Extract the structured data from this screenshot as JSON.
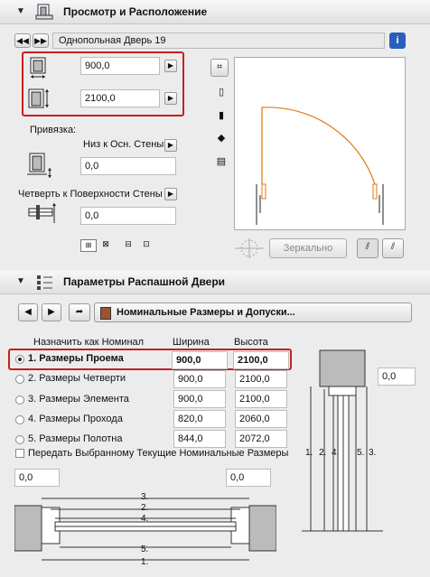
{
  "panel1": {
    "title": "Просмотр и Расположение",
    "door_name": "Однопольная Дверь 19",
    "width_value": "900,0",
    "height_value": "2100,0",
    "anchor_label": "Привязка:",
    "anchor_option": "Низ к Осн. Стены",
    "anchor_value": "0,0",
    "reveal_option": "Четверть к Поверхности Стены",
    "reveal_value": "0,0",
    "mirror_button": "Зеркально"
  },
  "panel2": {
    "title": "Параметры Распашной Двери",
    "page_selector": "Номинальные Размеры и Допуски...",
    "nominal_header": "Назначить как Номинал",
    "col_width": "Ширина",
    "col_height": "Высота",
    "rows": [
      {
        "label": "1. Размеры Проема",
        "width": "900,0",
        "height": "2100,0",
        "selected": true
      },
      {
        "label": "2. Размеры Четверти",
        "width": "900,0",
        "height": "2100,0",
        "selected": false
      },
      {
        "label": "3. Размеры Элемента",
        "width": "900,0",
        "height": "2100,0",
        "selected": false
      },
      {
        "label": "4. Размеры Прохода",
        "width": "820,0",
        "height": "2060,0",
        "selected": false
      },
      {
        "label": "5. Размеры Полотна",
        "width": "844,0",
        "height": "2072,0",
        "selected": false
      }
    ],
    "pass_checkbox": "Передать Выбранному Текущие Номинальные Размеры",
    "right_offset": "0,0",
    "left_bottom_value": "0,0",
    "right_bottom_value": "0,0",
    "section_numbers": [
      "1.",
      "2.",
      "4.",
      "5.",
      "3."
    ],
    "plan_numbers": [
      "3.",
      "2.",
      "4.",
      "5.",
      "1."
    ]
  },
  "colors": {
    "highlight": "#c81e1e",
    "door_swing": "#e07a10",
    "header_bg": "#e6e6e6"
  }
}
